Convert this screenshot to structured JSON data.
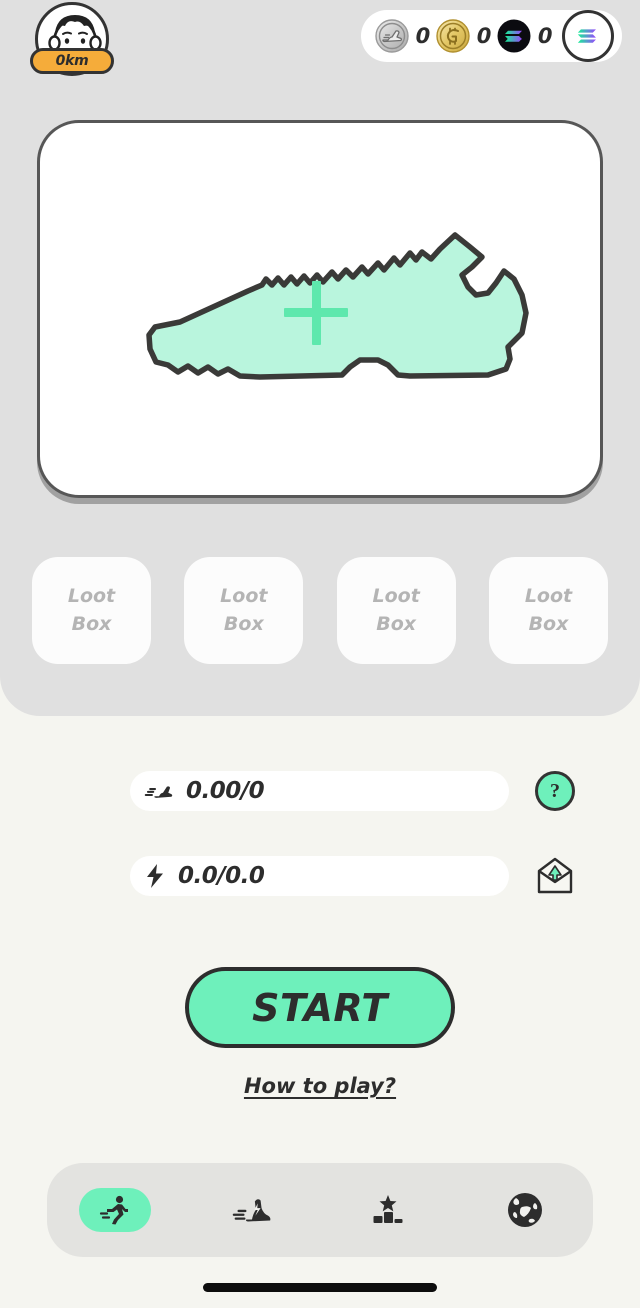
{
  "header": {
    "avatar": {
      "icon": "avatar-face-icon",
      "distance_badge": "0km"
    },
    "currencies": [
      {
        "name": "shoe-token",
        "icon": "silver-shoe-coin-icon",
        "value": "0"
      },
      {
        "name": "gold-token",
        "icon": "gold-coin-icon",
        "value": "0"
      },
      {
        "name": "solana-token",
        "icon": "solana-coin-icon",
        "value": "0"
      }
    ],
    "wallet_button": {
      "icon": "solana-logo-icon"
    }
  },
  "sneaker_card": {
    "icon": "sneaker-outline-icon",
    "add_icon": "plus-icon",
    "fill_color": "#b9f5dd",
    "outline_color": "#3a3a38"
  },
  "lootboxes": [
    {
      "line1": "Loot",
      "line2": "Box"
    },
    {
      "line1": "Loot",
      "line2": "Box"
    },
    {
      "line1": "Loot",
      "line2": "Box"
    },
    {
      "line1": "Loot",
      "line2": "Box"
    }
  ],
  "stats": {
    "steps": {
      "icon": "running-shoe-icon",
      "value": "0.00/0"
    },
    "energy": {
      "icon": "lightning-bolt-icon",
      "value": "0.0/0.0"
    },
    "help_button": {
      "icon": "question-mark-icon",
      "label": "?"
    },
    "mail_button": {
      "icon": "open-envelope-icon"
    }
  },
  "actions": {
    "start_label": "START",
    "how_to_play_label": "How to play?"
  },
  "bottom_nav": [
    {
      "name": "run",
      "icon": "running-person-icon",
      "active": true
    },
    {
      "name": "sneakers",
      "icon": "sneaker-speed-icon",
      "active": false
    },
    {
      "name": "leaderboard",
      "icon": "podium-star-icon",
      "active": false
    },
    {
      "name": "world",
      "icon": "globe-icon",
      "active": false
    }
  ],
  "colors": {
    "accent": "#6ef0bb",
    "panel": "#e0e0e0",
    "background": "#f5f5f0",
    "badge": "#f5ac3a",
    "dark": "#2d2d2d"
  }
}
